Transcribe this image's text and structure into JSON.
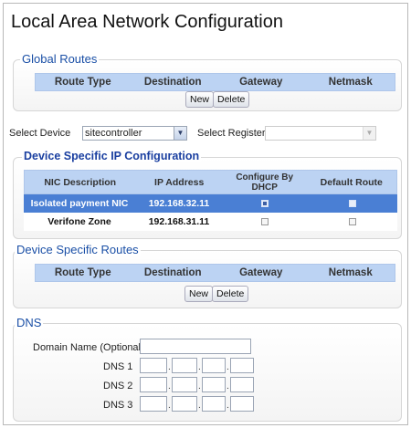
{
  "page_title": "Local Area Network Configuration",
  "global_routes": {
    "legend": "Global Routes",
    "columns": [
      "Route Type",
      "Destination",
      "Gateway",
      "Netmask"
    ],
    "new_label": "New",
    "delete_label": "Delete"
  },
  "selectors": {
    "device_label": "Select Device",
    "device_value": "sitecontroller",
    "register_label": "Select Register",
    "register_value": ""
  },
  "device_ip": {
    "legend": "Device Specific IP Configuration",
    "columns": [
      "NIC Description",
      "IP Address",
      "Configure By DHCP",
      "Default Route"
    ],
    "rows": [
      {
        "nic": "Isolated payment NIC",
        "ip": "192.168.32.11",
        "dhcp": true,
        "default_route": false,
        "selected": true
      },
      {
        "nic": "Verifone Zone",
        "ip": "192.168.31.11",
        "dhcp": false,
        "default_route": false,
        "selected": false
      }
    ]
  },
  "device_routes": {
    "legend": "Device Specific Routes",
    "columns": [
      "Route Type",
      "Destination",
      "Gateway",
      "Netmask"
    ],
    "new_label": "New",
    "delete_label": "Delete"
  },
  "dns": {
    "legend": "DNS",
    "domain_label": "Domain Name (Optional)",
    "domain_value": "",
    "server_labels": [
      "DNS 1",
      "DNS 2",
      "DNS 3"
    ],
    "separator": "."
  },
  "colors": {
    "legend_blue": "#1a4fa6",
    "header_bg": "#bcd3f3",
    "selected_row": "#4a7fd4"
  }
}
